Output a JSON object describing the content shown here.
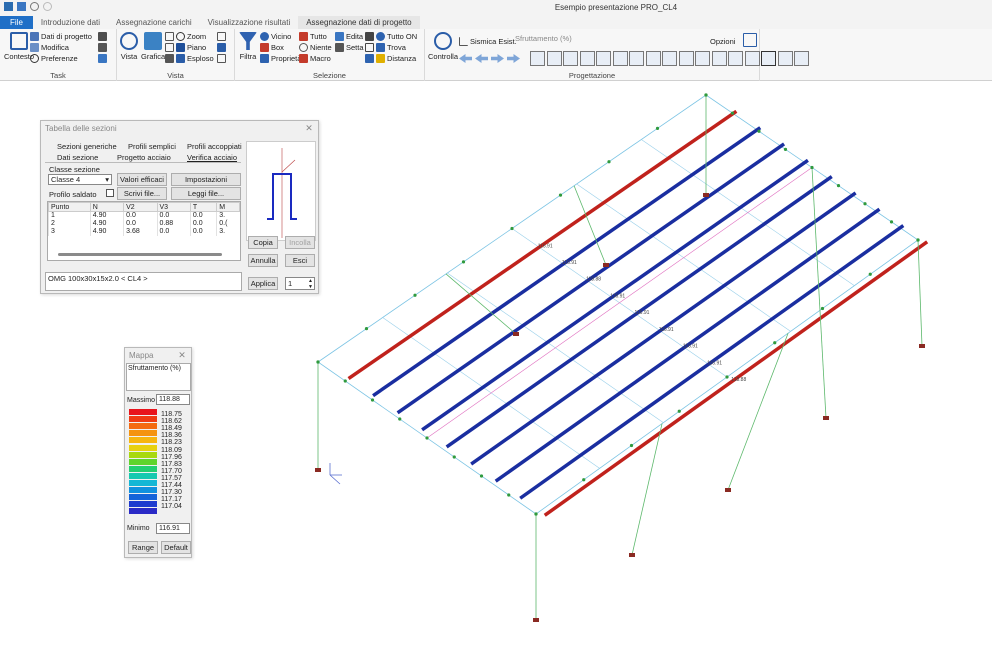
{
  "window": {
    "title": "Esempio presentazione PRO_CL4"
  },
  "tabs": [
    {
      "label": "File"
    },
    {
      "label": "Introduzione dati"
    },
    {
      "label": "Assegnazione carichi"
    },
    {
      "label": "Visualizzazione risultati"
    },
    {
      "label": "Assegnazione dati di progetto"
    }
  ],
  "ribbon": {
    "task": {
      "contesto": "Contesto",
      "dati_progetto": "Dati di progetto",
      "modifica": "Modifica",
      "preferenze": "Preferenze",
      "label": "Task"
    },
    "vista": {
      "vista": "Vista",
      "grafica": "Grafica",
      "zoom": "Zoom",
      "piano": "Piano",
      "esploso": "Esploso",
      "label": "Vista"
    },
    "selezione": {
      "filtra": "Filtra",
      "vicino": "Vicino",
      "box": "Box",
      "proprieta": "Proprietà",
      "tutto": "Tutto",
      "niente": "Niente",
      "macro": "Macro",
      "edita": "Edita",
      "setta": "Setta",
      "tutto_on": "Tutto ON",
      "trova": "Trova",
      "distanza": "Distanza",
      "label": "Selezione"
    },
    "progettazione": {
      "controlla": "Controlla",
      "sismica": "Sismica Esist.",
      "sfruttamento": "Sfruttamento (%)",
      "opzioni": "Opzioni",
      "label": "Progettazione"
    }
  },
  "sezioni_dialog": {
    "title": "Tabella delle sezioni",
    "tabs_row1": [
      "Sezioni generiche",
      "Profili semplici",
      "Profili accoppiati"
    ],
    "tabs_row2": [
      "Dati sezione",
      "Progetto acciaio",
      "Verifica acciaio"
    ],
    "classe_label": "Classe sezione",
    "classe_value": "Classe 4",
    "valori_efficaci": "Valori efficaci",
    "impostazioni": "Impostazioni avanzate...",
    "profilo_saldato": "Profilo saldato",
    "scrivi_file": "Scrivi file...",
    "leggi_file": "Leggi file...",
    "columns": [
      "Punto",
      "N",
      "V2",
      "V3",
      "T",
      "M"
    ],
    "rows": [
      [
        "1",
        "4.90",
        "0.0",
        "0.0",
        "0.0",
        "3."
      ],
      [
        "2",
        "4.90",
        "0.0",
        "0.88",
        "0.0",
        "0.("
      ],
      [
        "3",
        "4.90",
        "3.68",
        "0.0",
        "0.0",
        "3."
      ]
    ],
    "section_name": "OMG  100x30x15x2.0 < CL4 >",
    "copia": "Copia",
    "incolla": "Incolla",
    "annulla": "Annulla",
    "esci": "Esci",
    "applica": "Applica",
    "spin_value": "1"
  },
  "mappa": {
    "title": "Mappa",
    "type": "Sfruttamento (%)",
    "max_label": "Massimo",
    "max_value": "118.88",
    "min_label": "Minimo",
    "min_value": "116.91",
    "levels": [
      "118.75",
      "118.62",
      "118.49",
      "118.36",
      "118.23",
      "118.09",
      "117.96",
      "117.83",
      "117.70",
      "117.57",
      "117.44",
      "117.30",
      "117.17",
      "117.04"
    ],
    "colors": [
      "#e8141c",
      "#ef3b13",
      "#f46a10",
      "#f5930f",
      "#f7b50f",
      "#e8d10f",
      "#a8d90f",
      "#5fd42c",
      "#23cf72",
      "#16c9b0",
      "#14b7d5",
      "#1191de",
      "#1463d9",
      "#1e3bcf",
      "#2a2ac6"
    ],
    "range": "Range",
    "default": "Default"
  },
  "model_labels": [
    "116.91",
    "116.91",
    "118.88",
    "116.91",
    "116.91",
    "116.91",
    "116.91",
    "116.91",
    "118.88"
  ]
}
